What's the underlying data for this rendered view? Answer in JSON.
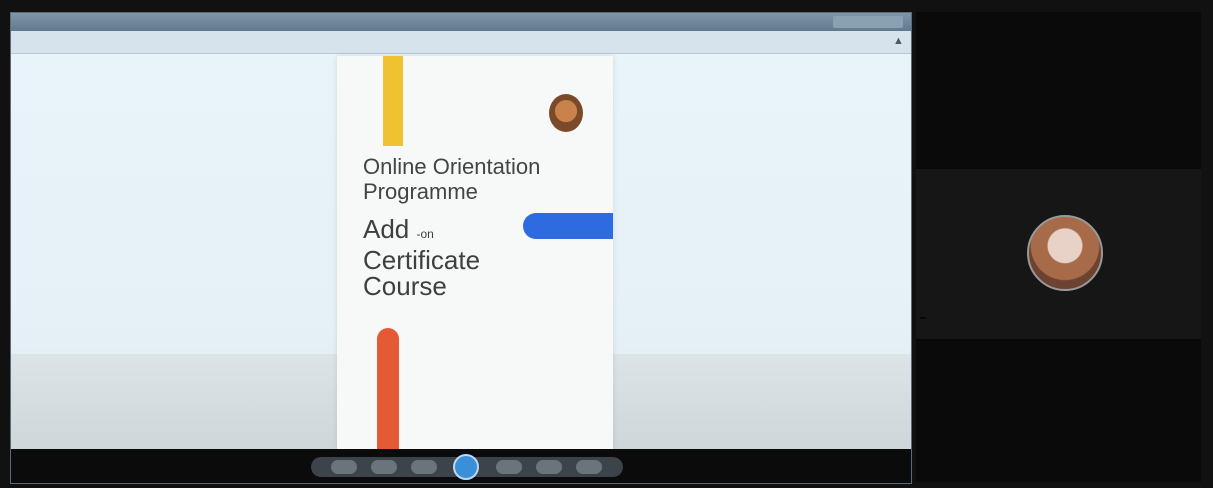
{
  "window": {
    "title": "",
    "tabs_text": ""
  },
  "document": {
    "heading": "Online Orientation Programme",
    "add": "Add",
    "on": "-on",
    "certificate": "Certificate",
    "course": "Course",
    "subtitle": "",
    "details": ""
  },
  "participants": {
    "active_name": ""
  },
  "icons": [
    "pin-icon",
    "org-logo",
    "participant-avatar"
  ],
  "colors": {
    "accent_blue": "#2f6be0",
    "stripe_yellow": "#f0c232",
    "stripe_red": "#e55934",
    "toolbar_accent": "#3a8fd8"
  }
}
